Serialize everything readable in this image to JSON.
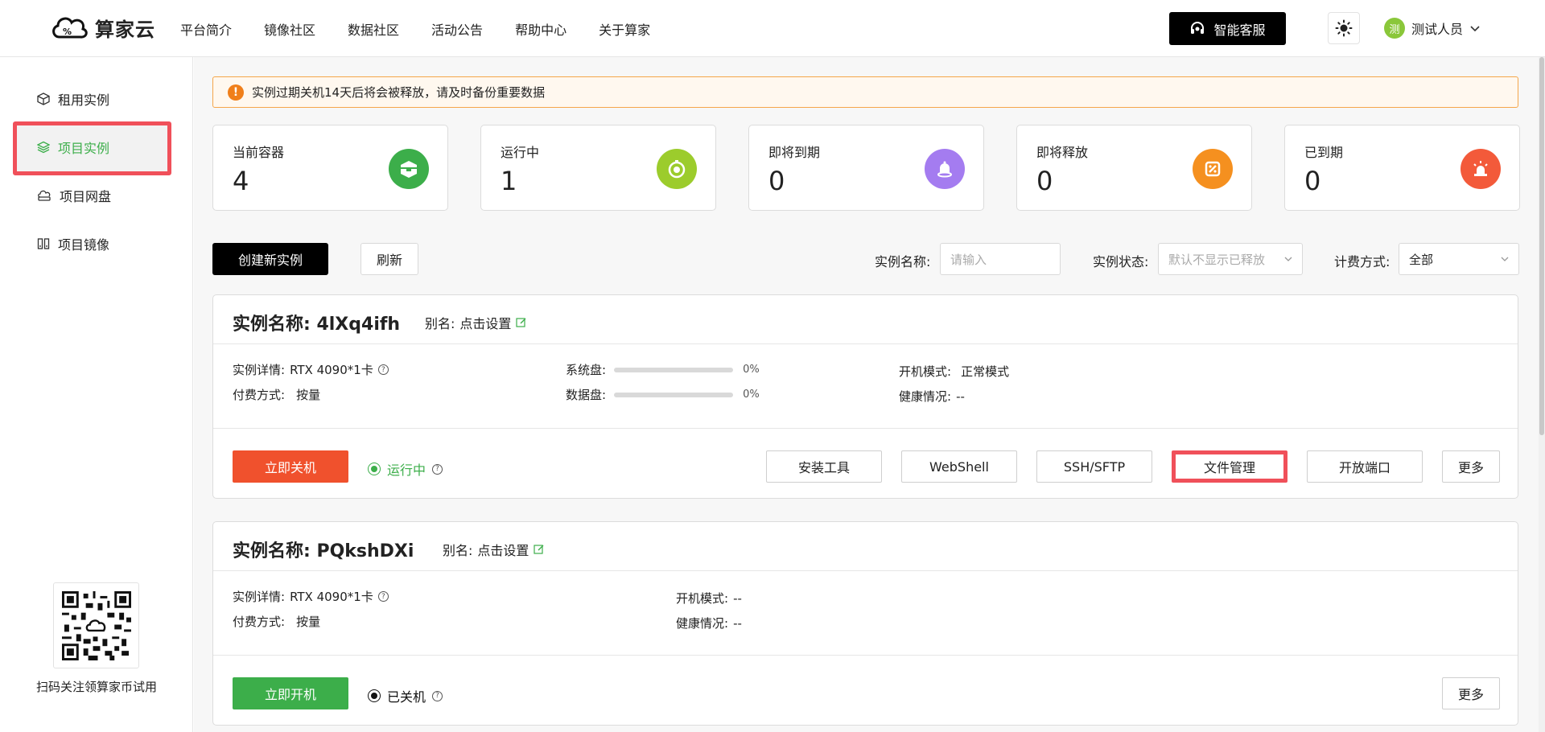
{
  "header": {
    "logo_text": "算家云",
    "nav": [
      "平台简介",
      "镜像社区",
      "数据社区",
      "活动公告",
      "帮助中心",
      "关于算家"
    ],
    "service_label": "智能客服",
    "user": {
      "avatar_char": "测",
      "name": "测试人员"
    }
  },
  "sidebar": {
    "items": [
      {
        "label": "租用实例",
        "icon": "box-icon"
      },
      {
        "label": "项目实例",
        "icon": "layers-icon",
        "active": true
      },
      {
        "label": "项目网盘",
        "icon": "cloud-disk-icon"
      },
      {
        "label": "项目镜像",
        "icon": "image-icon"
      }
    ],
    "qr_caption": "扫码关注领算家币试用"
  },
  "notice": "实例过期关机14天后将会被释放，请及时备份重要数据",
  "stats": [
    {
      "label": "当前容器",
      "value": "4",
      "color": "#3cae4a",
      "icon": "container-icon"
    },
    {
      "label": "运行中",
      "value": "1",
      "color": "#9ccc2c",
      "icon": "running-timer-icon"
    },
    {
      "label": "即将到期",
      "value": "0",
      "color": "#a47cf0",
      "icon": "bell-icon"
    },
    {
      "label": "即将释放",
      "value": "0",
      "color": "#f5901f",
      "icon": "release-icon"
    },
    {
      "label": "已到期",
      "value": "0",
      "color": "#f35a3a",
      "icon": "alarm-icon"
    }
  ],
  "toolbar": {
    "create_label": "创建新实例",
    "refresh_label": "刷新",
    "name_label": "实例名称:",
    "name_placeholder": "请输入",
    "status_label": "实例状态:",
    "status_placeholder": "默认不显示已释放",
    "billing_label": "计费方式:",
    "billing_value": "全部"
  },
  "instances": [
    {
      "title": "实例名称: 4lXq4ifh",
      "alias_label": "别名:",
      "alias_value": "点击设置",
      "detail_label": "实例详情:",
      "detail_value": "RTX 4090*1卡",
      "billing_label": "付费方式:",
      "billing_value": "按量",
      "sys_disk_label": "系统盘:",
      "sys_disk_pct": "0%",
      "data_disk_label": "数据盘:",
      "data_disk_pct": "0%",
      "boot_label": "开机模式:",
      "boot_value": "正常模式",
      "health_label": "健康情况:",
      "health_value": "--",
      "primary_action": "立即关机",
      "status": "运行中",
      "actions": [
        "安装工具",
        "WebShell",
        "SSH/SFTP",
        "文件管理",
        "开放端口",
        "更多"
      ]
    },
    {
      "title": "实例名称: PQkshDXi",
      "alias_label": "别名:",
      "alias_value": "点击设置",
      "detail_label": "实例详情:",
      "detail_value": "RTX 4090*1卡",
      "billing_label": "付费方式:",
      "billing_value": "按量",
      "boot_label": "开机模式:",
      "boot_value": "--",
      "health_label": "健康情况:",
      "health_value": "--",
      "primary_action": "立即开机",
      "status": "已关机",
      "actions": [
        "更多"
      ]
    }
  ]
}
